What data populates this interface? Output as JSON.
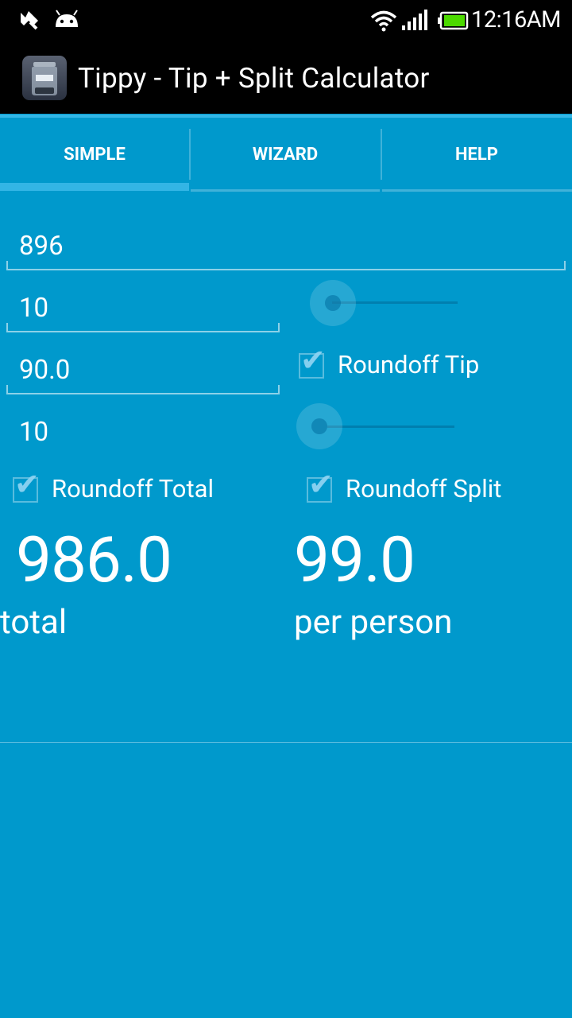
{
  "status_bar": {
    "time": "12:16AM",
    "icons": [
      "usb-debug-icon",
      "android-icon",
      "wifi-icon",
      "signal-icon",
      "battery-icon"
    ]
  },
  "app": {
    "title": "Tippy - Tip + Split Calculator",
    "icon": "tips-jar-icon"
  },
  "tabs": [
    {
      "label": "SIMPLE",
      "selected": true
    },
    {
      "label": "WIZARD",
      "selected": false
    },
    {
      "label": "HELP",
      "selected": false
    }
  ],
  "form": {
    "bill_amount": "896",
    "tip_percent": "10",
    "tip_amount": "90.0",
    "split_count": "10",
    "roundoff_tip": {
      "label": "Roundoff Tip",
      "checked": true
    },
    "roundoff_total": {
      "label": "Roundoff Total",
      "checked": true
    },
    "roundoff_split": {
      "label": "Roundoff Split",
      "checked": true
    }
  },
  "results": {
    "total_value": "986.0",
    "total_caption": "total",
    "per_person_value": "99.0",
    "per_person_caption": "per person"
  },
  "colors": {
    "background": "#0099cc",
    "accent": "#33b5e5",
    "bars": "#000000"
  }
}
